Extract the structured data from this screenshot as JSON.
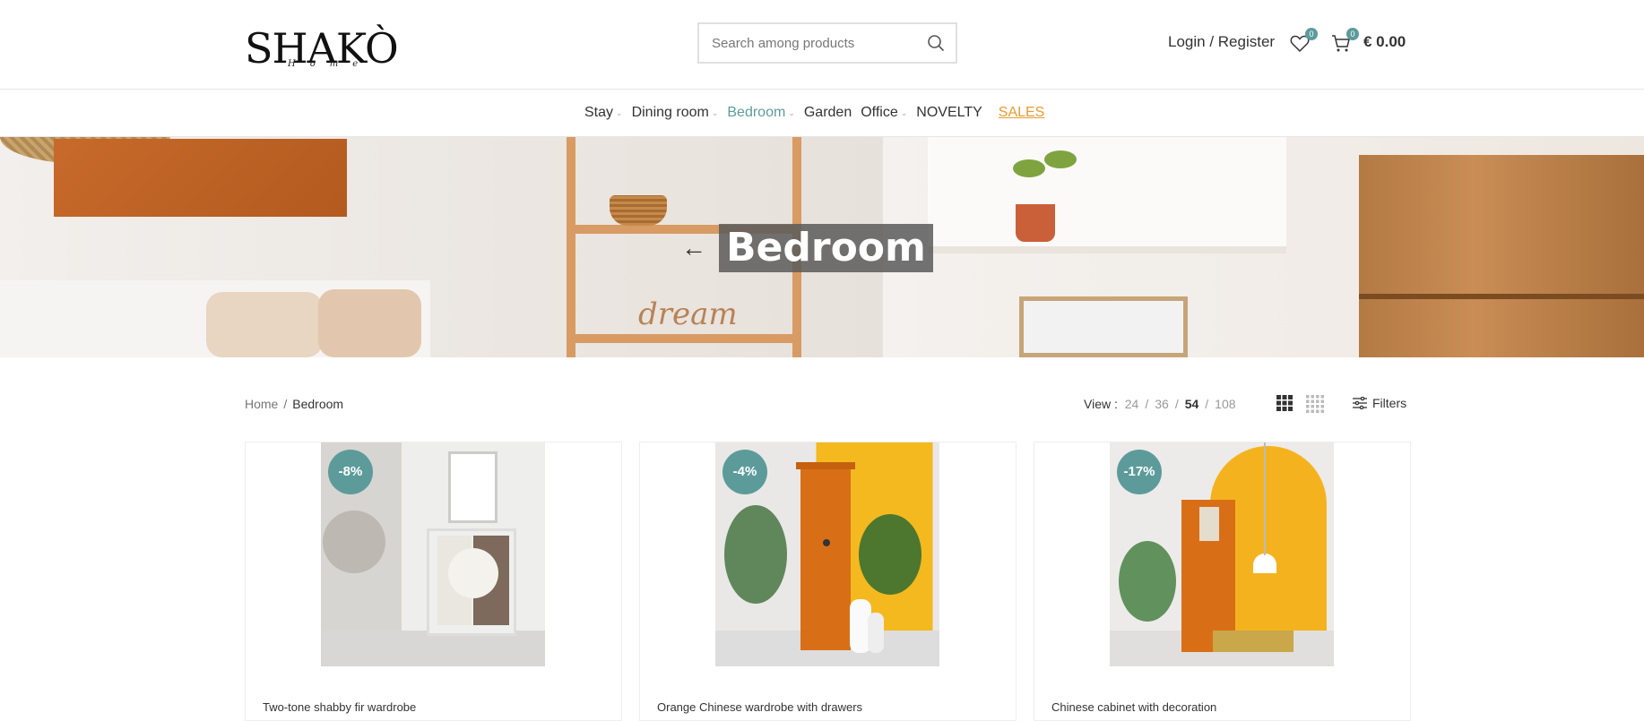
{
  "header": {
    "logo_text": "SHAKÒ",
    "logo_sub": "Home",
    "search_placeholder": "Search among products",
    "login_label": "Login / Register",
    "wishlist_count": "0",
    "cart_count": "0",
    "cart_total": "€ 0.00"
  },
  "nav": {
    "items": [
      {
        "label": "Stay"
      },
      {
        "label": "Dining room"
      },
      {
        "label": "Bedroom"
      },
      {
        "label": "Garden"
      },
      {
        "label": "Office"
      },
      {
        "label": "NOVELTY"
      },
      {
        "label": "SALES"
      }
    ]
  },
  "hero": {
    "title": "Bedroom",
    "shelf_text": "dream"
  },
  "breadcrumb": {
    "home": "Home",
    "separator": "/",
    "current": "Bedroom"
  },
  "toolbar": {
    "view_label": "View",
    "view_options": [
      "24",
      "36",
      "54",
      "108"
    ],
    "view_selected": "54",
    "separator": "/",
    "filters_label": "Filters"
  },
  "products": [
    {
      "title": "Two-tone shabby fir wardrobe",
      "discount": "-8%"
    },
    {
      "title": "Orange Chinese wardrobe with drawers",
      "discount": "-4%"
    },
    {
      "title": "Chinese cabinet with decoration",
      "discount": "-17%"
    }
  ],
  "colors": {
    "accent": "#5d9b9b",
    "sales": "#e89b2d"
  }
}
